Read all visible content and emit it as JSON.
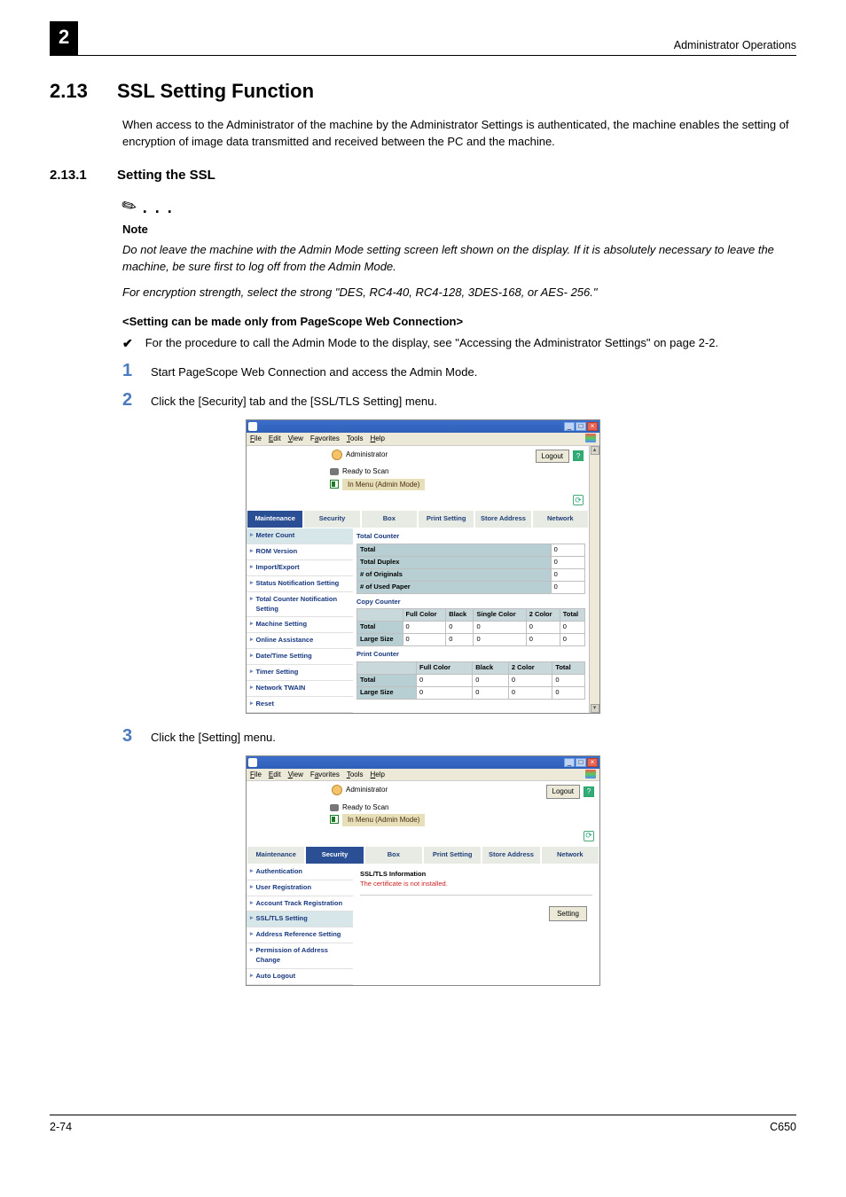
{
  "header": {
    "chapter_badge": "2",
    "right_text": "Administrator Operations"
  },
  "section": {
    "number": "2.13",
    "title": "SSL Setting Function",
    "intro": "When access to the Administrator of the machine by the Administrator Settings is authenticated, the machine enables the setting of encryption of image data transmitted and received between the PC and the machine."
  },
  "subsection": {
    "number": "2.13.1",
    "title": "Setting the SSL"
  },
  "note": {
    "ellipsis": ". . .",
    "label": "Note",
    "para1": "Do not leave the machine with the Admin Mode setting screen left shown on the display. If it is absolutely necessary to leave the machine, be sure first to log off from the Admin Mode.",
    "para2": "For encryption strength, select the strong \"DES, RC4-40, RC4-128, 3DES-168, or AES- 256.\""
  },
  "setting_heading": "<Setting can be made only from PageScope Web Connection>",
  "check_text": "For the procedure to call the Admin Mode to the display, see \"Accessing the Administrator Settings\" on page 2-2.",
  "steps": {
    "s1": {
      "n": "1",
      "t": "Start PageScope Web Connection and access the Admin Mode."
    },
    "s2": {
      "n": "2",
      "t": "Click the [Security] tab and the [SSL/TLS Setting] menu."
    },
    "s3": {
      "n": "3",
      "t": "Click the [Setting] menu."
    }
  },
  "browser_menus": {
    "file": "File",
    "edit": "Edit",
    "view": "View",
    "favorites": "Favorites",
    "tools": "Tools",
    "help": "Help"
  },
  "admin_header": {
    "role": "Administrator",
    "logout": "Logout",
    "help": "?",
    "ready": "Ready to Scan",
    "menu_mode": "In Menu (Admin Mode)"
  },
  "tabs": {
    "maintenance": "Maintenance",
    "security": "Security",
    "box": "Box",
    "print_setting": "Print Setting",
    "store_address": "Store Address",
    "network": "Network"
  },
  "shot1": {
    "sidebar": {
      "i0": "Meter Count",
      "i1": "ROM Version",
      "i2": "Import/Export",
      "i3": "Status Notification Setting",
      "i4": "Total Counter Notification Setting",
      "i5": "Machine Setting",
      "i6": "Online Assistance",
      "i7": "Date/Time Setting",
      "i8": "Timer Setting",
      "i9": "Network TWAIN",
      "i10": "Reset"
    },
    "panels": {
      "total_counter": "Total Counter",
      "copy_counter": "Copy Counter",
      "print_counter": "Print Counter"
    },
    "total_counter_rows": {
      "r0": {
        "label": "Total",
        "v": "0"
      },
      "r1": {
        "label": "Total Duplex",
        "v": "0"
      },
      "r2": {
        "label": "# of Originals",
        "v": "0"
      },
      "r3": {
        "label": "# of Used Paper",
        "v": "0"
      }
    },
    "copy_headers": {
      "c1": "Full Color",
      "c2": "Black",
      "c3": "Single Color",
      "c4": "2 Color",
      "c5": "Total"
    },
    "copy_rows": {
      "r0": {
        "label": "Total",
        "v1": "0",
        "v2": "0",
        "v3": "0",
        "v4": "0",
        "v5": "0"
      },
      "r1": {
        "label": "Large Size",
        "v1": "0",
        "v2": "0",
        "v3": "0",
        "v4": "0",
        "v5": "0"
      }
    },
    "print_headers": {
      "c1": "Full Color",
      "c2": "Black",
      "c3": "2 Color",
      "c4": "Total"
    },
    "print_rows": {
      "r0": {
        "label": "Total",
        "v1": "0",
        "v2": "0",
        "v3": "0",
        "v4": "0"
      },
      "r1": {
        "label": "Large Size",
        "v1": "0",
        "v2": "0",
        "v3": "0",
        "v4": "0"
      }
    }
  },
  "shot2": {
    "sidebar": {
      "i0": "Authentication",
      "i1": "User Registration",
      "i2": "Account Track Registration",
      "i3": "SSL/TLS Setting",
      "i4": "Address Reference Setting",
      "i5": "Permission of Address Change",
      "i6": "Auto Logout"
    },
    "ssl": {
      "title": "SSL/TLS Information",
      "warn": "The certificate is not installed.",
      "setting_btn": "Setting"
    }
  },
  "footer": {
    "left": "2-74",
    "right": "C650"
  }
}
